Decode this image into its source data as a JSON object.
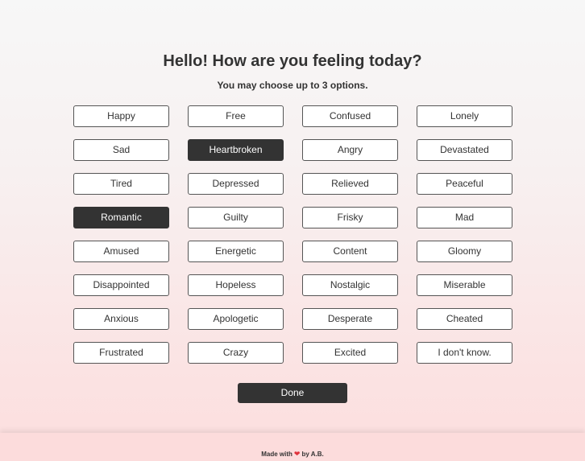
{
  "header": {
    "title": "Hello! How are you feeling today?",
    "subtitle": "You may choose up to 3 options."
  },
  "options": [
    {
      "label": "Happy",
      "selected": false
    },
    {
      "label": "Free",
      "selected": false
    },
    {
      "label": "Confused",
      "selected": false
    },
    {
      "label": "Lonely",
      "selected": false
    },
    {
      "label": "Sad",
      "selected": false
    },
    {
      "label": "Heartbroken",
      "selected": true
    },
    {
      "label": "Angry",
      "selected": false
    },
    {
      "label": "Devastated",
      "selected": false
    },
    {
      "label": "Tired",
      "selected": false
    },
    {
      "label": "Depressed",
      "selected": false
    },
    {
      "label": "Relieved",
      "selected": false
    },
    {
      "label": "Peaceful",
      "selected": false
    },
    {
      "label": "Romantic",
      "selected": true
    },
    {
      "label": "Guilty",
      "selected": false
    },
    {
      "label": "Frisky",
      "selected": false
    },
    {
      "label": "Mad",
      "selected": false
    },
    {
      "label": "Amused",
      "selected": false
    },
    {
      "label": "Energetic",
      "selected": false
    },
    {
      "label": "Content",
      "selected": false
    },
    {
      "label": "Gloomy",
      "selected": false
    },
    {
      "label": "Disappointed",
      "selected": false
    },
    {
      "label": "Hopeless",
      "selected": false
    },
    {
      "label": "Nostalgic",
      "selected": false
    },
    {
      "label": "Miserable",
      "selected": false
    },
    {
      "label": "Anxious",
      "selected": false
    },
    {
      "label": "Apologetic",
      "selected": false
    },
    {
      "label": "Desperate",
      "selected": false
    },
    {
      "label": "Cheated",
      "selected": false
    },
    {
      "label": "Frustrated",
      "selected": false
    },
    {
      "label": "Crazy",
      "selected": false
    },
    {
      "label": "Excited",
      "selected": false
    },
    {
      "label": "I don't know.",
      "selected": false
    }
  ],
  "actions": {
    "done_label": "Done"
  },
  "footer": {
    "made_with": "Made with",
    "heart_glyph": "❤",
    "by": "by A.B."
  },
  "colors": {
    "selected_bg": "#333333",
    "selected_text": "#ffffff",
    "heart": "#e0303a"
  },
  "icons": {
    "heart": "heart-icon"
  }
}
